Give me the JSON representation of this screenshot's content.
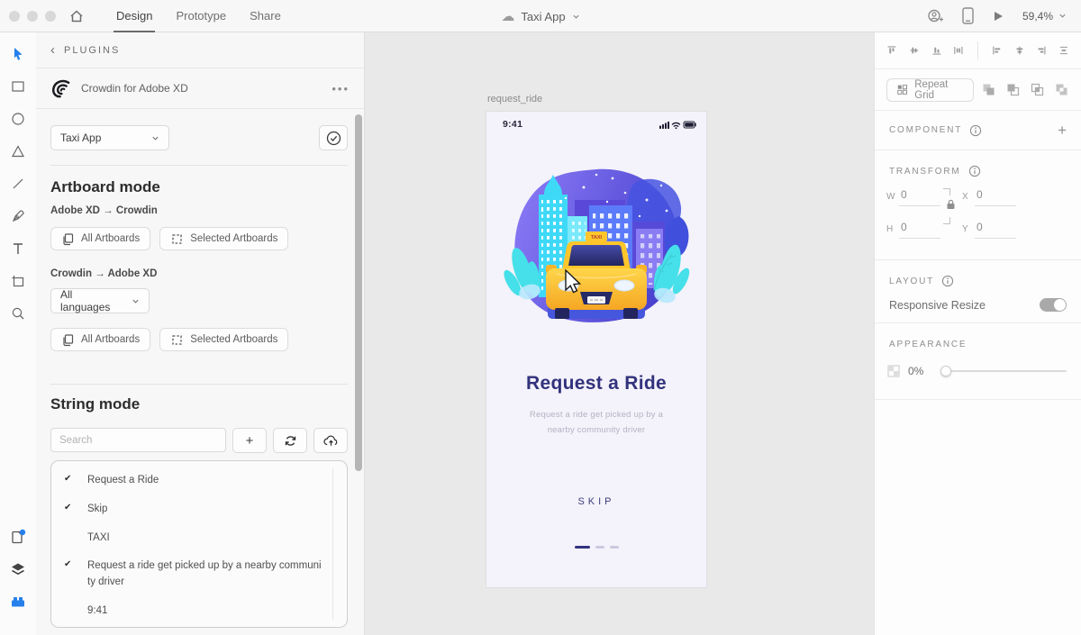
{
  "topbar": {
    "tabs": {
      "design": "Design",
      "prototype": "Prototype",
      "share": "Share"
    },
    "document_title": "Taxi App",
    "zoom_level": "59,4%"
  },
  "plugin_panel": {
    "back_label": "PLUGINS",
    "plugin_name": "Crowdin for Adobe XD",
    "project_select_value": "Taxi App",
    "artboard_mode": {
      "title": "Artboard mode",
      "xd_to_crowdin": "Adobe XD → Crowdin",
      "crowdin_to_xd": "Crowdin → Adobe XD",
      "all_artboards": "All Artboards",
      "selected_artboards": "Selected Artboards",
      "languages_select_value": "All languages"
    },
    "string_mode": {
      "title": "String mode",
      "search_placeholder": "Search",
      "strings": [
        {
          "checked": true,
          "text": "Request a Ride"
        },
        {
          "checked": true,
          "text": "Skip"
        },
        {
          "checked": false,
          "text": "TAXI"
        },
        {
          "checked": true,
          "text": "Request a ride get picked up by a nearby communi ty driver"
        },
        {
          "checked": false,
          "text": "9:41"
        }
      ]
    }
  },
  "canvas": {
    "artboard_label": "request_ride",
    "phone": {
      "status_time": "9:41",
      "taxi_sign": "TAXI",
      "heading": "Request a Ride",
      "subtitle_line1": "Request a ride get picked up by a",
      "subtitle_line2": "nearby community driver",
      "skip_label": "SKIP"
    }
  },
  "right_panel": {
    "repeat_grid_label": "Repeat Grid",
    "component_label": "COMPONENT",
    "transform_label": "TRANSFORM",
    "transform": {
      "w_label": "W",
      "h_label": "H",
      "x_label": "X",
      "y_label": "Y",
      "w": "0",
      "h": "0",
      "x": "0",
      "y": "0"
    },
    "layout_label": "LAYOUT",
    "responsive_resize_label": "Responsive Resize",
    "appearance_label": "APPEARANCE",
    "opacity_value": "0%"
  },
  "colors": {
    "accent_blue": "#2680eb",
    "heading_indigo": "#32327d",
    "taxi_yellow": "#ffc62b",
    "blob_purple": "#6f5df0"
  }
}
